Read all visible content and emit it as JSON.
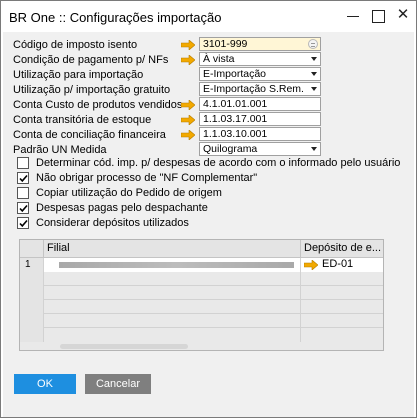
{
  "window": {
    "title": "BR One :: Configurações importação"
  },
  "form": {
    "fields": [
      {
        "label": "Código de imposto isento",
        "value": "3101-999"
      },
      {
        "label": "Condição de pagamento p/ NFs",
        "value": "À vista"
      },
      {
        "label": "Utilização para importação",
        "value": "E-Importação"
      },
      {
        "label": "Utilização p/ importação gratuito",
        "value": "E-Importação S.Rem."
      },
      {
        "label": "Conta Custo de produtos vendidos",
        "value": "4.1.01.01.001"
      },
      {
        "label": "Conta transitória de estoque",
        "value": "1.1.03.17.001"
      },
      {
        "label": "Conta de conciliação financeira",
        "value": "1.1.03.10.001"
      },
      {
        "label": "Padrão UN Medida",
        "value": "Quilograma"
      }
    ],
    "checkboxes": [
      {
        "label": "Determinar cód. imp. p/ despesas de acordo com o informado pelo usuário",
        "checked": false
      },
      {
        "label": "Não obrigar processo de \"NF Complementar\"",
        "checked": true
      },
      {
        "label": "Copiar utilização do Pedido de origem",
        "checked": false
      },
      {
        "label": "Despesas pagas pelo despachante",
        "checked": true
      },
      {
        "label": "Considerar depósitos utilizados",
        "checked": true
      }
    ]
  },
  "grid": {
    "columns": [
      "Filial",
      "Depósito de e..."
    ],
    "rows": [
      {
        "num": "1",
        "filial": "",
        "deposito": "ED-01"
      }
    ]
  },
  "buttons": {
    "ok": "OK",
    "cancel": "Cancelar"
  },
  "colors": {
    "arrow": "#f2a900",
    "ok_button": "#1e8fe0",
    "cancel_button": "#7f7f7f"
  },
  "icons": [
    "minimize-icon",
    "maximize-icon",
    "close-icon",
    "link-arrow-icon",
    "lookup-icon",
    "dropdown-icon",
    "checkmark-icon"
  ]
}
